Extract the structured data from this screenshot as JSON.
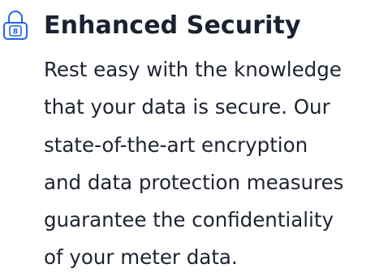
{
  "feature": {
    "icon": "padlock-icon",
    "accent_color": "#2563eb",
    "title": "Enhanced Security",
    "description_lines": [
      "Rest easy with the knowledge",
      "that your data is secure. Our",
      "state-of-the-art encryption",
      "and data protection measures",
      "guarantee the confidentiality",
      "of your meter data."
    ]
  }
}
